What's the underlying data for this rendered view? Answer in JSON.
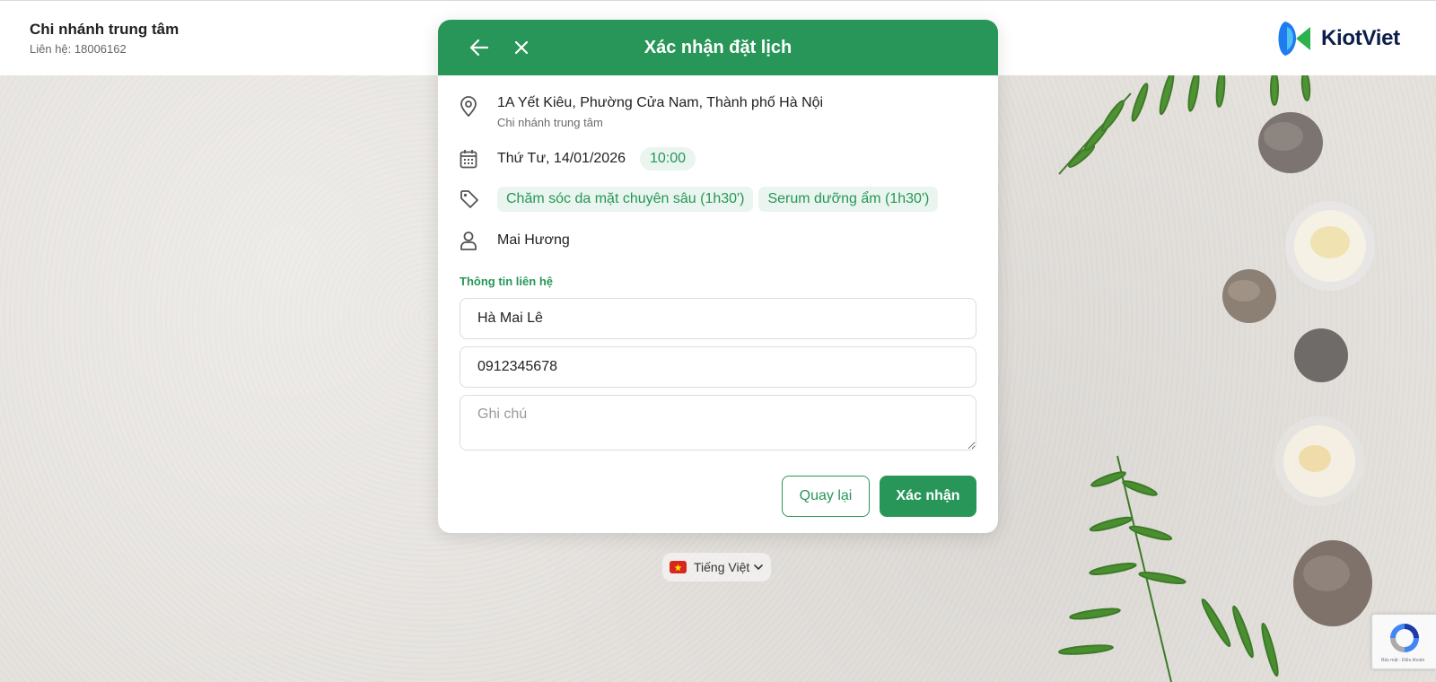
{
  "header": {
    "branch_name": "Chi nhánh trung tâm",
    "contact": "Liên hệ: 18006162",
    "logo_text": "KiotViet"
  },
  "modal": {
    "title": "Xác nhận đặt lịch",
    "address": "1A Yết Kiêu, Phường Cửa Nam, Thành phố Hà Nội",
    "branch": "Chi nhánh trung tâm",
    "date": "Thứ Tư, 14/01/2026",
    "time": "10:00",
    "services": [
      {
        "name": "Chăm sóc da mặt chuyên sâu",
        "duration": "(1h30')"
      },
      {
        "name": "Serum dưỡng ẩm",
        "duration": "(1h30')"
      }
    ],
    "staff": "Mai Hương",
    "contact_section_label": "Thông tin liên hệ",
    "name_value": "Hà Mai Lê",
    "phone_value": "0912345678",
    "note_placeholder": "Ghi chú",
    "back_button": "Quay lại",
    "confirm_button": "Xác nhận"
  },
  "language": {
    "selected": "Tiếng Việt"
  },
  "recaptcha": {
    "footer_text": "Bảo mật - Điều khoản"
  },
  "colors": {
    "primary": "#279658",
    "chip_bg": "#e9f5ee",
    "logo_blue": "#1e7bf0",
    "logo_green": "#2bb24c",
    "logo_text": "#0c1f4a"
  },
  "icons": {
    "back": "arrow-left-icon",
    "close": "close-icon",
    "location": "map-pin-icon",
    "calendar": "calendar-icon",
    "service": "tag-icon",
    "staff": "user-icon",
    "language": "vietnam-flag-icon",
    "dropdown": "chevron-down-icon"
  }
}
